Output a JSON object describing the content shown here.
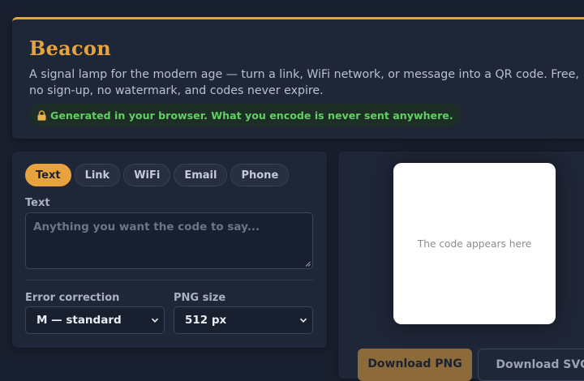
{
  "header": {
    "title": "Beacon",
    "description": "A signal lamp for the modern age — turn a link, WiFi network, or message into a QR code. Free, no sign-up, no watermark, and codes never expire.",
    "privacy_note": "Generated in your browser. What you encode is never sent anywhere."
  },
  "tabs": [
    {
      "label": "Text",
      "active": true
    },
    {
      "label": "Link",
      "active": false
    },
    {
      "label": "WiFi",
      "active": false
    },
    {
      "label": "Email",
      "active": false
    },
    {
      "label": "Phone",
      "active": false
    }
  ],
  "form": {
    "text_label": "Text",
    "text_placeholder": "Anything you want the code to say...",
    "text_value": "",
    "error_correction_label": "Error correction",
    "error_correction_value": "M — standard",
    "png_size_label": "PNG size",
    "png_size_value": "512 px"
  },
  "preview": {
    "placeholder": "The code appears here"
  },
  "actions": {
    "download_png": "Download PNG",
    "download_svg": "Download SVG"
  },
  "colors": {
    "accent": "#e7a33e",
    "background": "#181f2e",
    "panel": "#1f2637",
    "privacy_green": "#62cf63"
  },
  "icons": {
    "privacy": "lock-icon",
    "select": "chevron-down-icon"
  }
}
